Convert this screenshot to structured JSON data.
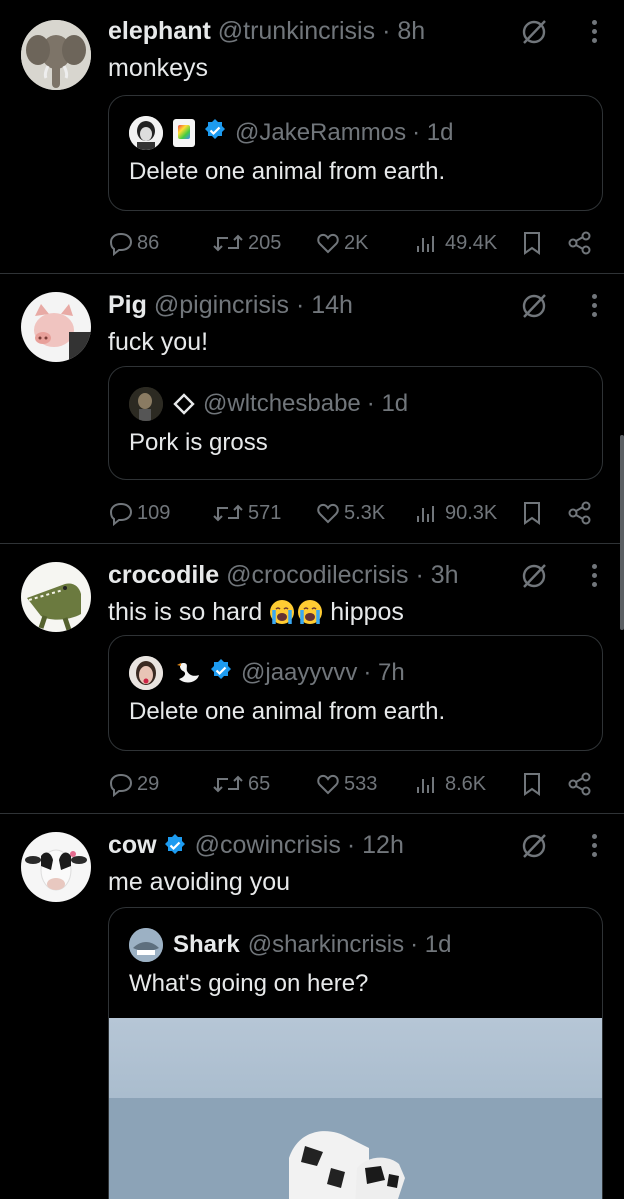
{
  "tweets": [
    {
      "name": "elephant",
      "handle": "@trunkincrisis",
      "time": "· 8h",
      "text": "monkeys",
      "avatar_icon": "elephant-avatar",
      "quote": {
        "handle": "@JakeRammos",
        "time": "· 1d",
        "text": "Delete one animal from earth.",
        "verified": true
      },
      "stats": {
        "replies": "86",
        "reposts": "205",
        "likes": "2K",
        "views": "49.4K"
      }
    },
    {
      "name": "Pig",
      "handle": "@pigincrisis",
      "time": "· 14h",
      "text": "fuck you!",
      "avatar_icon": "pig-avatar",
      "quote": {
        "handle": "@wltchesbabe",
        "time": "· 1d",
        "text": "Pork is gross",
        "verified": false
      },
      "stats": {
        "replies": "109",
        "reposts": "571",
        "likes": "5.3K",
        "views": "90.3K"
      }
    },
    {
      "name": "crocodile",
      "handle": "@crocodilecrisis",
      "time": "· 3h",
      "text": "this is so hard",
      "text_after": "hippos",
      "avatar_icon": "crocodile-avatar",
      "quote": {
        "handle": "@jaayyvvv",
        "time": "· 7h",
        "text": "Delete one animal from earth.",
        "verified": true
      },
      "stats": {
        "replies": "29",
        "reposts": "65",
        "likes": "533",
        "views": "8.6K"
      }
    },
    {
      "name": "cow",
      "handle": "@cowincrisis",
      "time": "· 12h",
      "text": "me avoiding you",
      "avatar_icon": "cow-avatar",
      "quote": {
        "name": "Shark",
        "handle": "@sharkincrisis",
        "time": "· 1d",
        "text": "What's going on here?"
      }
    }
  ],
  "colors": {
    "background": "#000000",
    "muted": "#71767b",
    "verified": "#1d9bf0",
    "border": "#2f3336"
  }
}
